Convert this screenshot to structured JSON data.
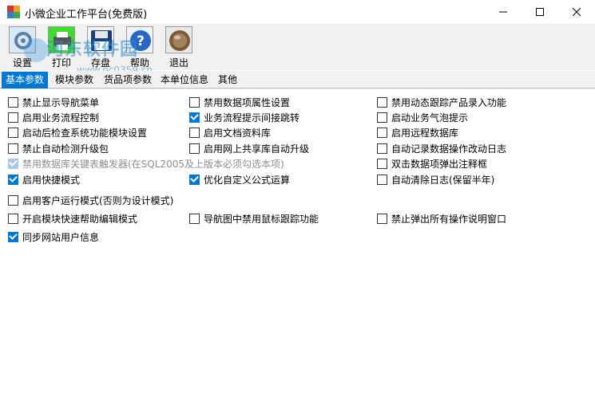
{
  "window": {
    "title": "小微企业工作平台(免费版)"
  },
  "watermark": {
    "title": "河东软件园",
    "subtitle": "www.pc0359.cn"
  },
  "toolbar": {
    "settings": "设置",
    "print": "打印",
    "save": "存盘",
    "help": "帮助",
    "exit": "退出"
  },
  "tabs": [
    {
      "label": "基本参数",
      "active": true
    },
    {
      "label": "模块参数",
      "active": false
    },
    {
      "label": "货品项参数",
      "active": false
    },
    {
      "label": "本单位信息",
      "active": false
    },
    {
      "label": "其他",
      "active": false
    }
  ],
  "options": {
    "o1": {
      "label": "禁止显示导航菜单",
      "checked": false
    },
    "o2": {
      "label": "禁用数据项属性设置",
      "checked": false
    },
    "o3": {
      "label": "禁用动态跟踪产品录入功能",
      "checked": false
    },
    "o4": {
      "label": "启用业务流程控制",
      "checked": false
    },
    "o5": {
      "label": "业务流程提示间接跳转",
      "checked": true
    },
    "o6": {
      "label": "启动业务气泡提示",
      "checked": false
    },
    "o7": {
      "label": "启动后检查系统功能模块设置",
      "checked": false
    },
    "o8": {
      "label": "启用文档资料库",
      "checked": false
    },
    "o9": {
      "label": "启用远程数据库",
      "checked": false
    },
    "o10": {
      "label": "禁止自动检测升级包",
      "checked": false
    },
    "o11": {
      "label": "启用网上共享库自动升级",
      "checked": false
    },
    "o12": {
      "label": "自动记录数据操作改动日志",
      "checked": false
    },
    "o13": {
      "label": "禁用数据库关键表触发器(在SQL2005及上版本必须勾选本项)",
      "checked": true,
      "disabled": true
    },
    "o14": {
      "label": "双击数据项弹出注释框",
      "checked": false
    },
    "o15": {
      "label": "启用快捷模式",
      "checked": true
    },
    "o16": {
      "label": "优化自定义公式运算",
      "checked": true
    },
    "o17": {
      "label": "自动清除日志(保留半年)",
      "checked": false
    },
    "o18": {
      "label": "启用客户运行模式(否则为设计模式)",
      "checked": false
    },
    "o19": {
      "label": "开启模块快速帮助编辑模式",
      "checked": false
    },
    "o20": {
      "label": "导航图中禁用鼠标跟踪功能",
      "checked": false
    },
    "o21": {
      "label": "禁止弹出所有操作说明窗口",
      "checked": false
    },
    "o22": {
      "label": "同步网站用户信息",
      "checked": true
    }
  },
  "colors": {
    "accent": "#0078d7",
    "toolbar_bg": "#f0f0f0"
  }
}
